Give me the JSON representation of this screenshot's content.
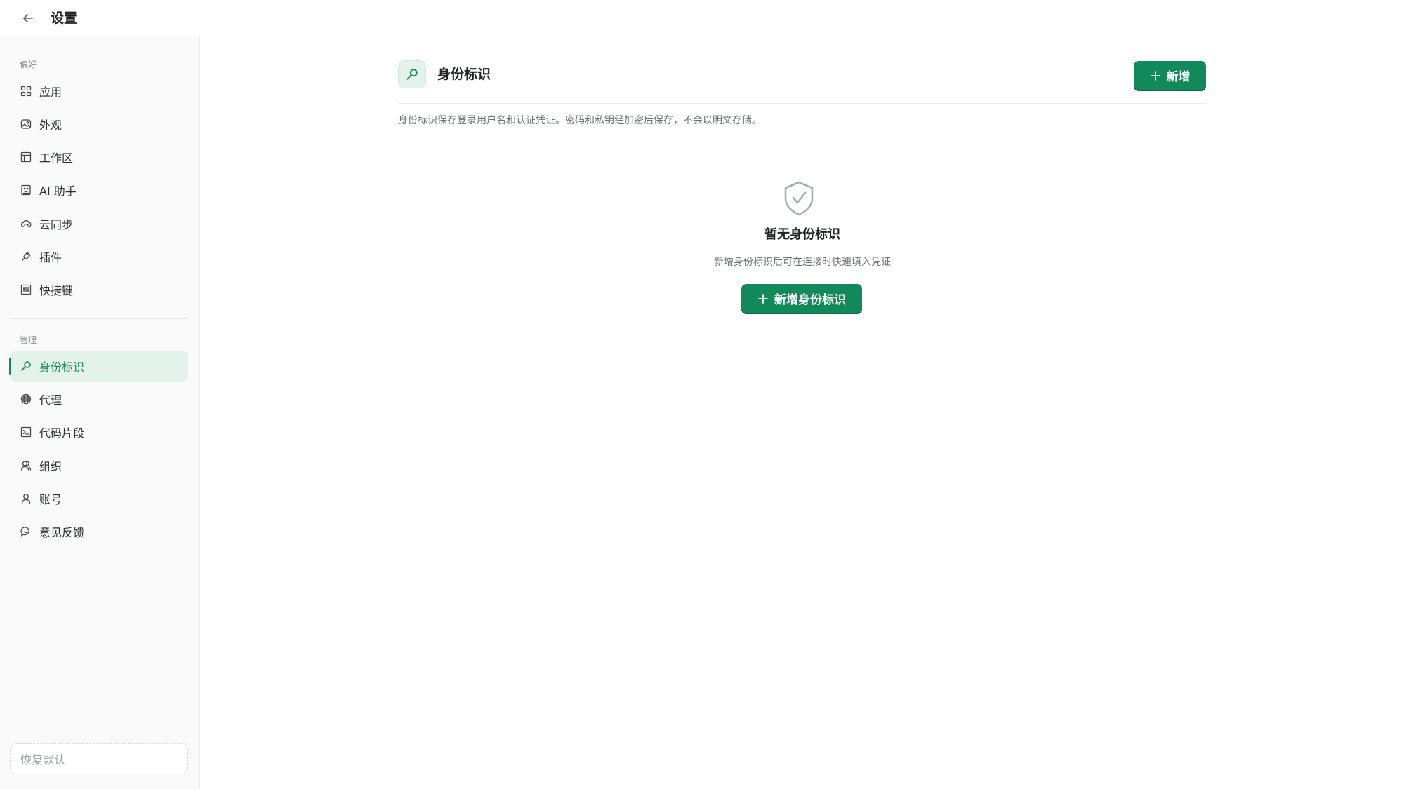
{
  "topbar": {
    "title": "设置"
  },
  "sidebar": {
    "section_preferences": "偏好",
    "section_manage": "管理",
    "items": [
      {
        "label": "应用",
        "icon": "grid-icon"
      },
      {
        "label": "外观",
        "icon": "image-icon"
      },
      {
        "label": "工作区",
        "icon": "layout-icon"
      },
      {
        "label": "AI 助手",
        "icon": "ai-assistant-icon"
      },
      {
        "label": "云同步",
        "icon": "cloud-sync-icon"
      },
      {
        "label": "插件",
        "icon": "plug-icon"
      },
      {
        "label": "快捷键",
        "icon": "keyboard-icon"
      },
      {
        "label": "身份标识",
        "icon": "key-icon"
      },
      {
        "label": "代理",
        "icon": "globe-icon"
      },
      {
        "label": "代码片段",
        "icon": "terminal-icon"
      },
      {
        "label": "组织",
        "icon": "users-icon"
      },
      {
        "label": "账号",
        "icon": "user-icon"
      },
      {
        "label": "意见反馈",
        "icon": "chat-icon"
      }
    ],
    "active_item": "身份标识",
    "reset_label": "恢复默认"
  },
  "main": {
    "header_icon": "key-icon",
    "title": "身份标识",
    "add_label": "新增",
    "description": "身份标识保存登录用户名和认证凭证。密码和私钥经加密后保存，不会以明文存储。",
    "empty": {
      "icon": "shield-check-icon",
      "title": "暂无身份标识",
      "subtitle": "新增身份标识后可在连接时快速填入凭证",
      "button_label": "新增身份标识"
    }
  },
  "colors": {
    "accent": "#12895a",
    "accent_light": "#e3f3ea",
    "sidebar_bg": "#fafafa",
    "text_muted": "#6b7078"
  }
}
